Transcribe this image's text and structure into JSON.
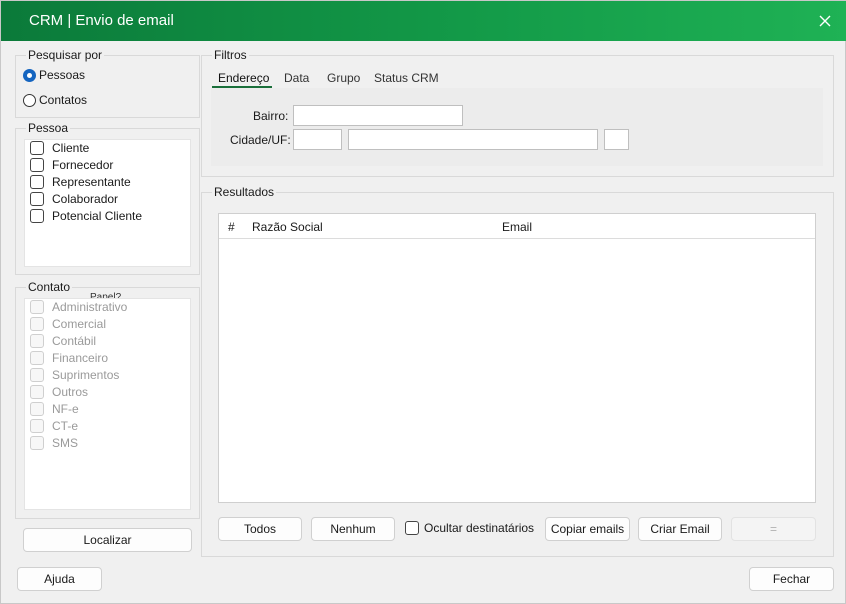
{
  "window": {
    "title": "CRM | Envio de email",
    "close_icon": "close-icon"
  },
  "search_by": {
    "title": "Pesquisar por",
    "options": [
      {
        "label": "Pessoas",
        "selected": true
      },
      {
        "label": "Contatos",
        "selected": false
      }
    ]
  },
  "person": {
    "title": "Pessoa",
    "items": [
      {
        "label": "Cliente",
        "checked": false
      },
      {
        "label": "Fornecedor",
        "checked": false
      },
      {
        "label": "Representante",
        "checked": false
      },
      {
        "label": "Colaborador",
        "checked": false
      },
      {
        "label": "Potencial Cliente",
        "checked": false
      }
    ]
  },
  "contact": {
    "title": "Contato",
    "overlap_text": "Papel?",
    "items": [
      {
        "label": "Administrativo",
        "enabled": false
      },
      {
        "label": "Comercial",
        "enabled": false
      },
      {
        "label": "Contábil",
        "enabled": false
      },
      {
        "label": "Financeiro",
        "enabled": false
      },
      {
        "label": "Suprimentos",
        "enabled": false
      },
      {
        "label": "Outros",
        "enabled": false
      },
      {
        "label": "NF-e",
        "enabled": false
      },
      {
        "label": "CT-e",
        "enabled": false
      },
      {
        "label": "SMS",
        "enabled": false
      }
    ]
  },
  "locate_button": "Localizar",
  "filters": {
    "title": "Filtros",
    "tabs": [
      {
        "label": "Endereço",
        "active": true
      },
      {
        "label": "Data",
        "active": false
      },
      {
        "label": "Grupo",
        "active": false
      },
      {
        "label": "Status CRM",
        "active": false
      }
    ],
    "bairro_label": "Bairro:",
    "bairro_value": "",
    "cidade_label": "Cidade/UF:",
    "cidade_code_value": "",
    "cidade_name_value": "",
    "uf_value": ""
  },
  "results": {
    "title": "Resultados",
    "columns": [
      "#",
      "Razão Social",
      "Email"
    ],
    "rows": []
  },
  "actions": {
    "all": "Todos",
    "none": "Nenhum",
    "hide_recipients": {
      "label": "Ocultar destinatários",
      "checked": false
    },
    "copy_emails": "Copiar emails",
    "create_email": "Criar Email",
    "disabled_button": "="
  },
  "footer": {
    "help": "Ajuda",
    "close": "Fechar"
  },
  "colors": {
    "title_bar_start": "#0b7a3a",
    "title_bar_end": "#1fb255",
    "radio_selected": "#1565c0",
    "tab_underline": "#1a6f3a"
  }
}
